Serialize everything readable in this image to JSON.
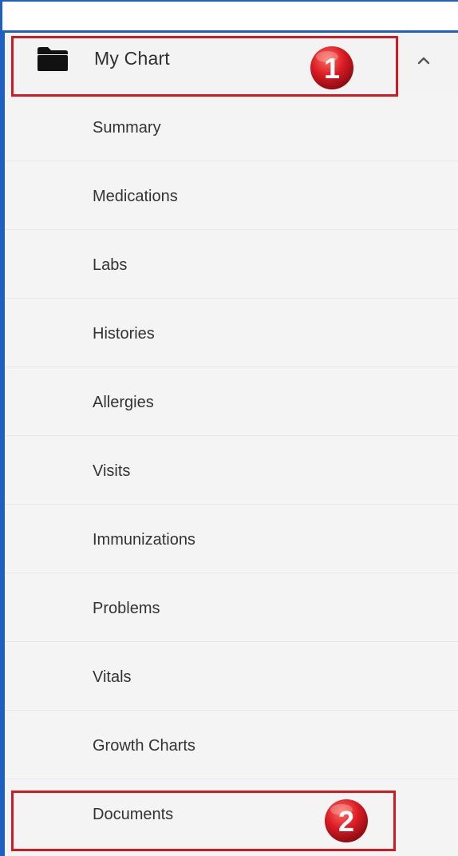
{
  "header": {
    "title": "My Chart",
    "folder_icon": "folder-icon",
    "collapse_icon": "chevron-up-icon"
  },
  "menu": {
    "items": [
      {
        "label": "Summary"
      },
      {
        "label": "Medications"
      },
      {
        "label": "Labs"
      },
      {
        "label": "Histories"
      },
      {
        "label": "Allergies"
      },
      {
        "label": "Visits"
      },
      {
        "label": "Immunizations"
      },
      {
        "label": "Problems"
      },
      {
        "label": "Vitals"
      },
      {
        "label": "Growth Charts"
      },
      {
        "label": "Documents"
      }
    ]
  },
  "callouts": [
    {
      "number": "1"
    },
    {
      "number": "2"
    }
  ],
  "colors": {
    "accent_border": "#1f5fbf",
    "highlight": "#d11a24",
    "badge": "#d91b24"
  }
}
